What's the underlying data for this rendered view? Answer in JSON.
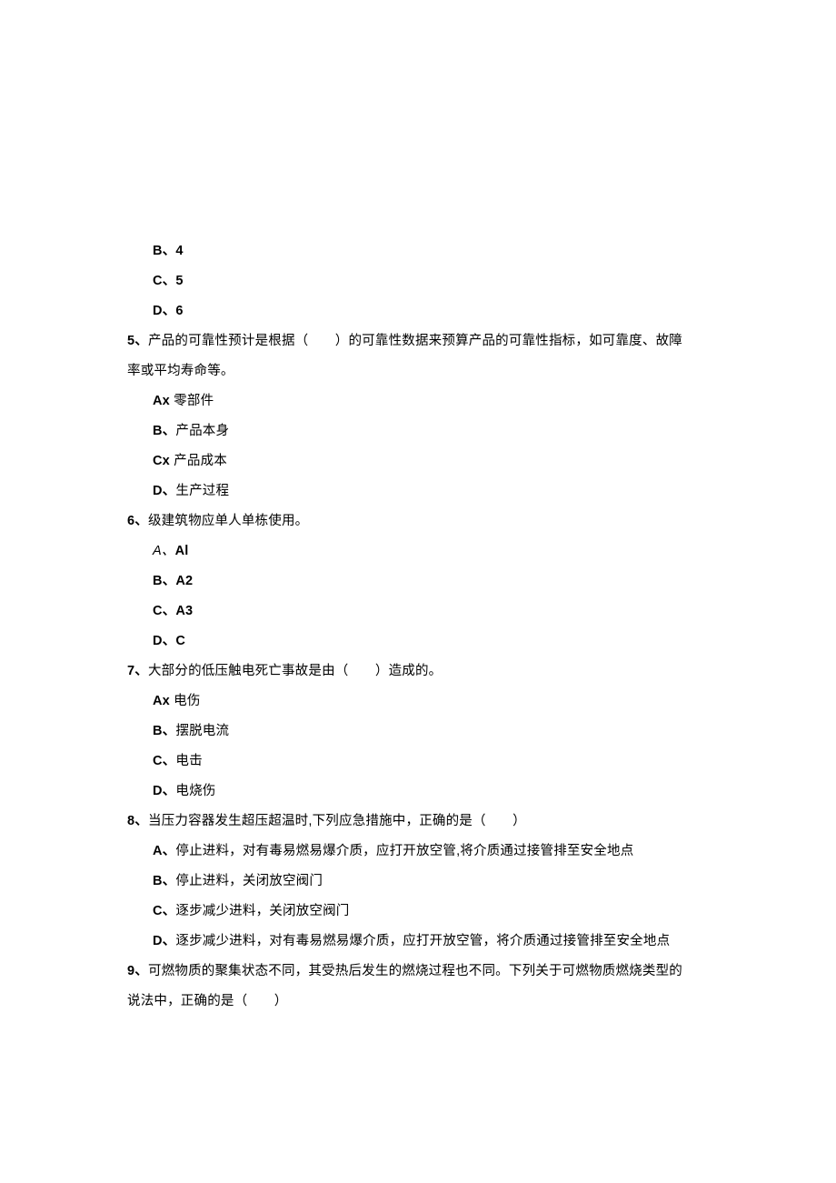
{
  "q4_partial_options": {
    "b": {
      "label": "B、",
      "text": "4"
    },
    "c": {
      "label": "C、",
      "text": "5"
    },
    "d": {
      "label": "D、",
      "text": "6"
    }
  },
  "q5": {
    "num": "5、",
    "stem_before": "产品的可靠性预计是根据（　　）的可靠性数据来预算产品的可靠性指标，如可靠度、故障",
    "stem_wrap": "率或平均寿命等。",
    "a": {
      "label": "Ax",
      "text": " 零部件"
    },
    "b": {
      "label": "B、",
      "text": "产品本身"
    },
    "c": {
      "label": "Cx",
      "text": " 产品成本"
    },
    "d": {
      "label": "D、",
      "text": "生产过程"
    }
  },
  "q6": {
    "num": "6、",
    "stem": "级建筑物应单人单栋使用。",
    "a": {
      "label_a": "A、",
      "label_al": "Al"
    },
    "b": {
      "label": "B、",
      "text": "A2"
    },
    "c": {
      "label": "C、",
      "text": "A3"
    },
    "d": {
      "label": "D、",
      "text": "C"
    }
  },
  "q7": {
    "num": "7、",
    "stem": "大部分的低压触电死亡事故是由（　　）造成的。",
    "a": {
      "label": "Ax",
      "text": " 电伤"
    },
    "b": {
      "label": "B、",
      "text": "摆脱电流"
    },
    "c": {
      "label": "C、",
      "text": "电击"
    },
    "d": {
      "label": "D、",
      "text": "电烧伤"
    }
  },
  "q8": {
    "num": "8、",
    "stem": "当压力容器发生超压超温时,下列应急措施中，正确的是（　　）",
    "a": {
      "label": "A、",
      "text": "停止进料，对有毒易燃易爆介质，应打开放空管,将介质通过接管排至安全地点"
    },
    "b": {
      "label": "B、",
      "text": "停止进料，关闭放空阀门"
    },
    "c": {
      "label": "C、",
      "text": "逐步减少进料，关闭放空阀门"
    },
    "d": {
      "label": "D、",
      "text": "逐步减少进料，对有毒易燃易爆介质，应打开放空管，将介质通过接管排至安全地点"
    }
  },
  "q9": {
    "num": "9、",
    "stem_1": "可燃物质的聚集状态不同，其受热后发生的燃烧过程也不同。下列关于可燃物质燃烧类型的",
    "stem_2": "说法中，正确的是（　　）"
  }
}
